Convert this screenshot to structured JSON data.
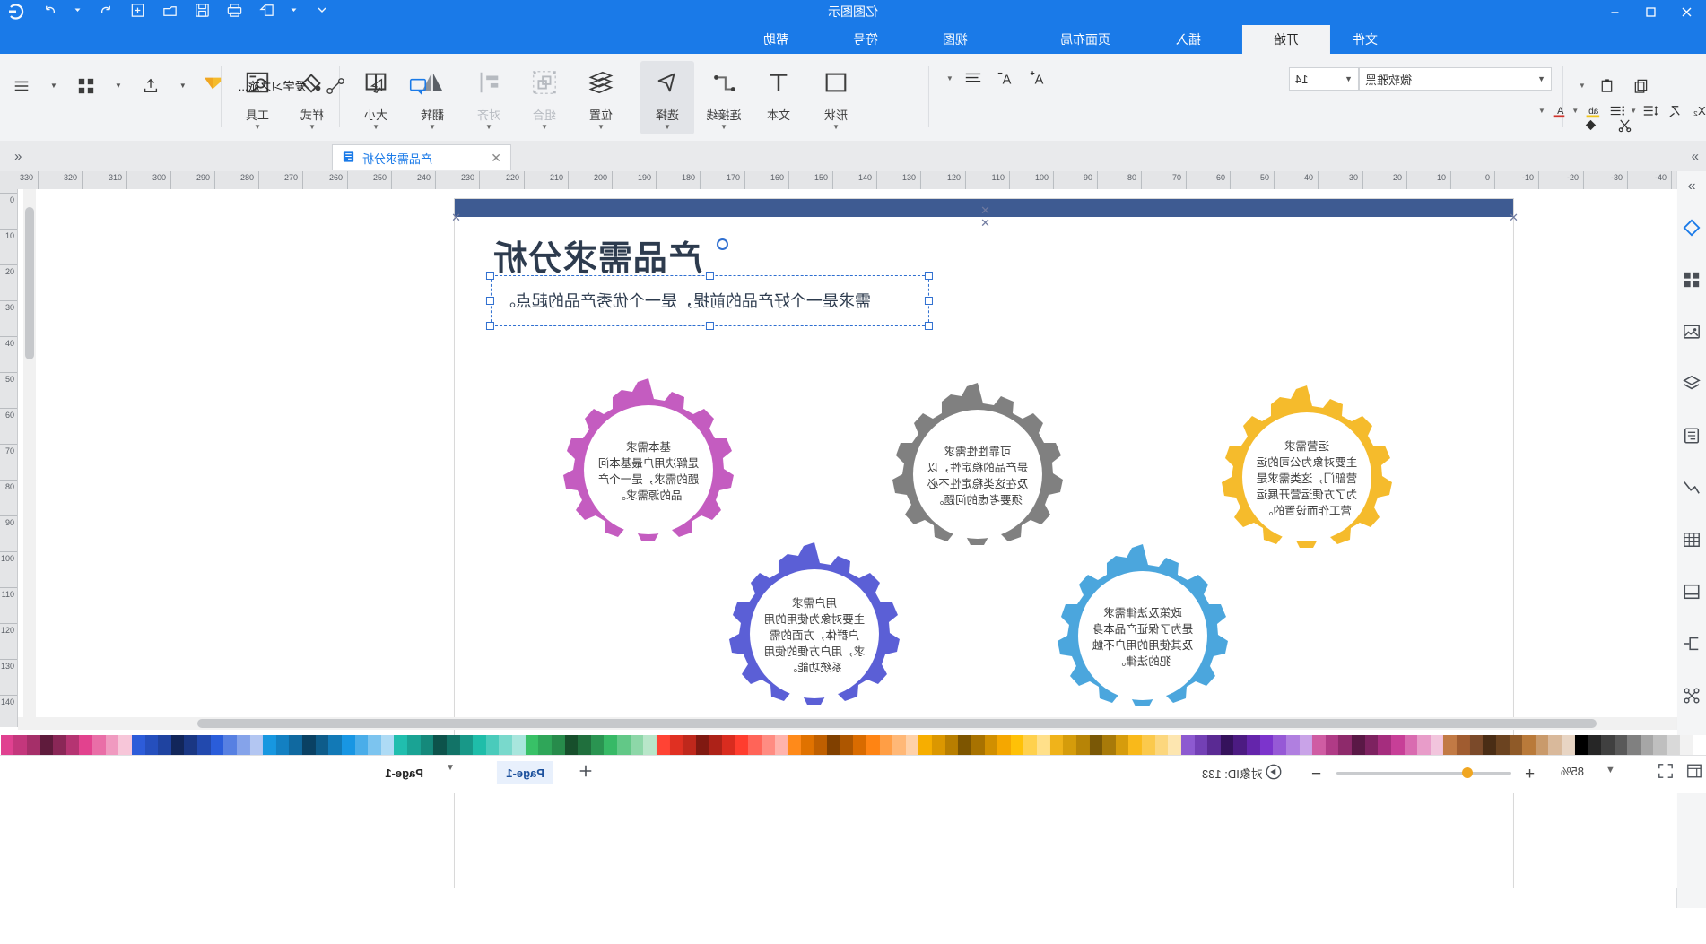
{
  "app": {
    "document_title": "亿图图示",
    "titlebar_icons": [
      "minimize-icon",
      "restore-icon",
      "close-icon"
    ],
    "quick_access_icons": [
      "save-icon",
      "new-icon",
      "open-icon",
      "print-icon",
      "export-icon",
      "undo-icon",
      "redo-icon",
      "customize-icon"
    ]
  },
  "tabs": [
    {
      "label": "文件",
      "active": false
    },
    {
      "label": "开始",
      "active": true
    },
    {
      "label": "插入",
      "active": false
    },
    {
      "label": "页面布局",
      "active": false
    },
    {
      "label": "视图",
      "active": false
    },
    {
      "label": "符号",
      "active": false
    },
    {
      "label": "帮助",
      "active": false
    }
  ],
  "ribbon": {
    "groups": [
      {
        "label": "形状",
        "icon": "square-icon",
        "dim": false,
        "selected": false,
        "caret": true
      },
      {
        "label": "文本",
        "icon": "text-t-icon",
        "dim": false,
        "selected": false,
        "caret": false
      },
      {
        "label": "连接线",
        "icon": "connector-icon",
        "dim": false,
        "selected": false,
        "caret": true
      },
      {
        "label": "选择",
        "icon": "cursor-arrow-icon",
        "dim": false,
        "selected": true,
        "caret": true
      },
      {
        "label": "位置",
        "icon": "position-icon",
        "dim": false,
        "selected": false,
        "caret": true
      },
      {
        "label": "组合",
        "icon": "group-icon",
        "dim": true,
        "selected": false,
        "caret": true
      },
      {
        "label": "对齐",
        "icon": "align-icon",
        "dim": true,
        "selected": false,
        "caret": true
      },
      {
        "label": "翻转",
        "icon": "flip-icon",
        "dim": false,
        "selected": false,
        "caret": true
      },
      {
        "label": "大小",
        "icon": "size-icon",
        "dim": false,
        "selected": false,
        "caret": true
      },
      {
        "label": "样式",
        "icon": "fill-bucket-icon",
        "dim": false,
        "selected": false,
        "caret": true
      },
      {
        "label": "工具",
        "icon": "tools-icon",
        "dim": false,
        "selected": false,
        "caret": true
      }
    ],
    "font": {
      "family": "微软雅黑",
      "size": "14"
    },
    "format_buttons": [
      "bold-icon",
      "italic-icon",
      "underline-icon",
      "strikethrough-icon",
      "superscript-icon",
      "subscript-icon",
      "clear-format-icon",
      "bullet-list-icon",
      "line-spacing-icon",
      "text-color-icon",
      "highlight-icon",
      "font-color-a-icon",
      "align-text-icon",
      "increase-font-icon",
      "decrease-font-icon",
      "copy-icon",
      "paste-icon",
      "cut-icon",
      "format-painter-icon"
    ]
  },
  "doc_tab": {
    "label": "产品需求分析",
    "close": "✕",
    "file_icon": "document-icon"
  },
  "rail": {
    "top_icon": "expand-panels-icon",
    "items": [
      "shape-library-icon",
      "templates-icon",
      "image-icon",
      "layers-icon",
      "notes-icon",
      "chart-icon",
      "table-icon",
      "frame-icon",
      "container-icon",
      "connector-tools-icon"
    ]
  },
  "ruler": {
    "h_labels": [
      "-40",
      "-30",
      "-20",
      "-10",
      "0",
      "10",
      "20",
      "30",
      "40",
      "50",
      "60",
      "70",
      "80",
      "90",
      "100",
      "110",
      "120",
      "130",
      "140",
      "150",
      "160",
      "170",
      "180",
      "190",
      "200",
      "210",
      "220",
      "230",
      "240",
      "250",
      "260",
      "270",
      "280",
      "290",
      "300",
      "310",
      "320",
      "330"
    ],
    "v_labels": [
      "0",
      "10",
      "20",
      "30",
      "40",
      "50",
      "60",
      "70",
      "80",
      "90",
      "100",
      "110",
      "120",
      "130",
      "140"
    ]
  },
  "slide": {
    "title": "产品需求分析",
    "subtitle": "需求是一个好产品的前提，是一个优秀产品的起点。",
    "gears": [
      {
        "id": "gear-operations",
        "color": "#f5bb2c",
        "title": "运营需求",
        "body": "主要对象为公司的运营部门，这类需求是为了方便运营开展运营工作而设置的。"
      },
      {
        "id": "gear-policy",
        "color": "#4ba6dd",
        "title": "政策及法律需求",
        "body": "是为了保证产品本身及其使用的用户不触犯的法律。"
      },
      {
        "id": "gear-reliability",
        "color": "#808080",
        "title": "可靠性性需求",
        "body": "是产品的稳定性，以及在这类稳定性不必须要考虑的问题。"
      },
      {
        "id": "gear-user",
        "color": "#5b5fd6",
        "title": "用户需求",
        "body": "主要对象为使用的用户群体，方面的需求，用户方便的使用系统功能。"
      },
      {
        "id": "gear-basic",
        "color": "#c45cc0",
        "title": "基本需求",
        "body": "是解决用户最基本问题的需求，是一个产品的源需求。"
      }
    ]
  },
  "palette": {
    "colors": [
      "#ffffff",
      "#f2f2f2",
      "#d9d9d9",
      "#bfbfbf",
      "#a6a6a6",
      "#808080",
      "#595959",
      "#404040",
      "#262626",
      "#000000",
      "#e8d5c4",
      "#d9b99b",
      "#c99a6b",
      "#b97a3a",
      "#8f5a28",
      "#6b4320",
      "#4a2d15",
      "#7b4a2a",
      "#a05c30",
      "#c27a45",
      "#f2c5dd",
      "#e89cc9",
      "#d96bb0",
      "#c73f97",
      "#a52d7e",
      "#7d2260",
      "#5a1846",
      "#8e2a6b",
      "#b03b86",
      "#cf5ca3",
      "#c9a3e8",
      "#b07fe0",
      "#9659d6",
      "#7c34cc",
      "#6425ab",
      "#4c1b82",
      "#35125c",
      "#5a2a93",
      "#7340b5",
      "#8d5ad0",
      "#fde6b0",
      "#fcd77e",
      "#fbc94c",
      "#f9b91a",
      "#d69c0c",
      "#a87a09",
      "#7a5806",
      "#b78407",
      "#d59c0b",
      "#f0b31a",
      "#ffe08a",
      "#ffd14d",
      "#ffc107",
      "#f5a700",
      "#d18f00",
      "#a87200",
      "#7d5500",
      "#b87e00",
      "#db9700",
      "#f7ae00",
      "#ffd1a8",
      "#ffb877",
      "#ff9e45",
      "#ff8413",
      "#d96b00",
      "#ad5600",
      "#804000",
      "#bf5f00",
      "#e07200",
      "#ff8a1a",
      "#ffb3ac",
      "#ff8c82",
      "#ff6458",
      "#ff3d2e",
      "#d92c1f",
      "#ad2218",
      "#801911",
      "#bf281c",
      "#e03022",
      "#ff4334",
      "#b8e6c9",
      "#8dd7a8",
      "#62c887",
      "#37b966",
      "#2a9451",
      "#206f3d",
      "#174f2c",
      "#278b4b",
      "#2fa659",
      "#38c167",
      "#a8e6dd",
      "#79d9cc",
      "#4acbbb",
      "#1fbda9",
      "#189888",
      "#127367",
      "#0d534b",
      "#15897b",
      "#1aa394",
      "#20beae",
      "#aedbf5",
      "#7cc4ef",
      "#4aade9",
      "#1896e3",
      "#1279b6",
      "#0e5c8a",
      "#0a4163",
      "#1069a0",
      "#1380c2",
      "#1797e0",
      "#b3c6f2",
      "#85a3ea",
      "#5780e2",
      "#2a5dda",
      "#2249ae",
      "#1a3783",
      "#12265a",
      "#1f43a0",
      "#254fbd",
      "#2d5cd9",
      "#f7c6d9",
      "#f09ac0",
      "#e96ea7",
      "#e2428e",
      "#b53472",
      "#8a2757",
      "#5f1b3c",
      "#a52f69",
      "#c3377c",
      "#e04190"
    ]
  },
  "status": {
    "object_id_label": "对象ID: 133",
    "zoom_label": "85%",
    "zoom_minus": "−",
    "zoom_plus": "+",
    "page_prev": "Page-1",
    "page_current": "Page-1",
    "fit_icon": "fit-page-icon",
    "fullscreen_icon": "fullscreen-icon",
    "presentation_icon": "presentation-icon",
    "add_page_icon": "add-page-icon",
    "layout_icon": "layout-icon"
  }
}
